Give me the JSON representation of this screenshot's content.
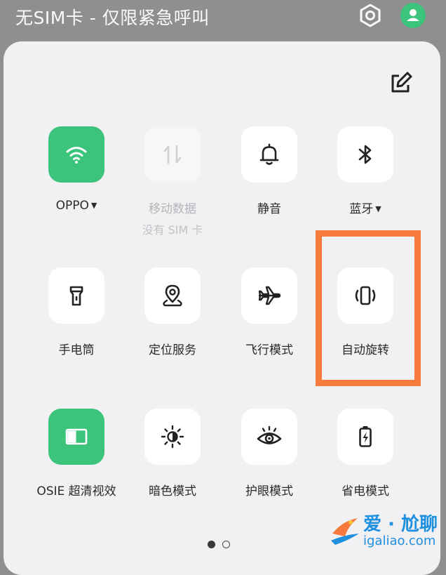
{
  "status_bar": {
    "title": "无SIM卡 - 仅限紧急呼叫",
    "settings_icon": "gear-hexagon-icon",
    "avatar_icon": "user-avatar-icon",
    "avatar_color": "#3cc47c"
  },
  "panel": {
    "edit_icon": "edit-icon"
  },
  "tiles": [
    {
      "label": "OPPO",
      "has_dropdown": true,
      "icon": "wifi-icon",
      "state": "on"
    },
    {
      "label": "移动数据",
      "sublabel": "没有 SIM 卡",
      "icon": "mobile-data-icon",
      "state": "disabled"
    },
    {
      "label": "静音",
      "icon": "bell-icon",
      "state": "off"
    },
    {
      "label": "蓝牙",
      "has_dropdown": true,
      "icon": "bluetooth-icon",
      "state": "off"
    },
    {
      "label": "手电筒",
      "icon": "flashlight-icon",
      "state": "off"
    },
    {
      "label": "定位服务",
      "icon": "location-icon",
      "state": "off"
    },
    {
      "label": "飞行模式",
      "icon": "airplane-icon",
      "state": "off"
    },
    {
      "label": "自动旋转",
      "icon": "auto-rotate-icon",
      "state": "off",
      "highlighted": true
    },
    {
      "label": "OSIE 超清视效",
      "icon": "osie-icon",
      "state": "on"
    },
    {
      "label": "暗色模式",
      "icon": "dark-mode-icon",
      "state": "off"
    },
    {
      "label": "护眼模式",
      "icon": "eye-care-icon",
      "state": "off"
    },
    {
      "label": "省电模式",
      "icon": "battery-saver-icon",
      "state": "off"
    }
  ],
  "pager": {
    "pages": 2,
    "current": 1
  },
  "accent_color": "#3cc47c",
  "highlight_color": "#f57a3b",
  "watermark": {
    "top": "爱 · 尬聊",
    "bottom": "igaliao.com"
  }
}
